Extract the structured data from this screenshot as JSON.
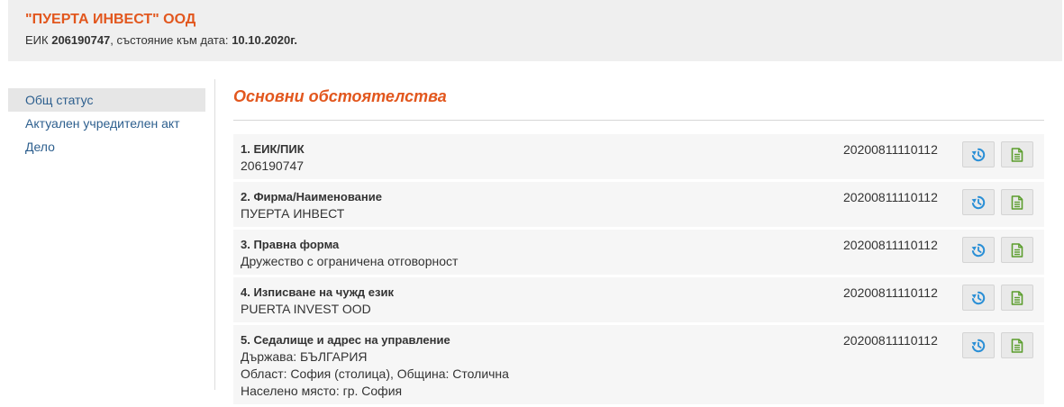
{
  "header": {
    "company_name": "\"ПУЕРТА ИНВЕСТ\" ООД",
    "eik_label": "ЕИК",
    "eik_value": "206190747",
    "state_label": ", състояние към дата:",
    "state_date": "10.10.2020г."
  },
  "sidebar": {
    "items": [
      {
        "label": "Общ статус"
      },
      {
        "label": "Актуален учредителен акт"
      },
      {
        "label": "Дело"
      }
    ]
  },
  "main": {
    "section_title": "Основни обстоятелства",
    "rows": [
      {
        "title": "1. ЕИК/ПИК",
        "values": [
          "206190747"
        ],
        "code": "20200811110112"
      },
      {
        "title": "2. Фирма/Наименование",
        "values": [
          "ПУЕРТА ИНВЕСТ"
        ],
        "code": "20200811110112"
      },
      {
        "title": "3. Правна форма",
        "values": [
          "Дружество с ограничена отговорност"
        ],
        "code": "20200811110112"
      },
      {
        "title": "4. Изписване на чужд език",
        "values": [
          "PUERTA INVEST OOD"
        ],
        "code": "20200811110112"
      },
      {
        "title": "5. Седалище и адрес на управление",
        "values": [
          "Държава: БЪЛГАРИЯ",
          "Област: София (столица), Община: Столична",
          "Населено място: гр. София"
        ],
        "code": "20200811110112"
      }
    ]
  },
  "icons": {
    "history": "history-icon",
    "document": "document-icon"
  },
  "colors": {
    "accent": "#e2571e",
    "link": "#2d5f8e",
    "history_icon": "#2a8fd6",
    "document_icon": "#5c9e2e"
  }
}
